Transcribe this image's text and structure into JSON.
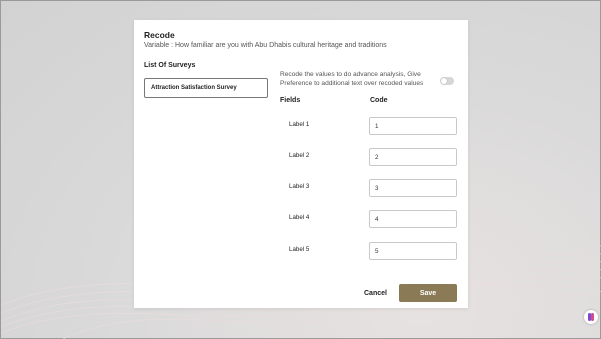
{
  "modal": {
    "title": "Recode",
    "variable": "Variable : How familiar are you with Abu Dhabis cultural heritage and traditions"
  },
  "surveys": {
    "heading": "List Of Surveys",
    "items": [
      "Attraction Satisfaction Survey"
    ]
  },
  "recode": {
    "note": "Recode the values to do advance analysis, Give Preference to additional text over recoded values",
    "toggle_on": false
  },
  "table": {
    "fields_header": "Fields",
    "code_header": "Code",
    "rows": [
      {
        "label": "Label 1",
        "code": "1"
      },
      {
        "label": "Label 2",
        "code": "2"
      },
      {
        "label": "Label 3",
        "code": "3"
      },
      {
        "label": "Label 4",
        "code": "4"
      },
      {
        "label": "Label 5",
        "code": "5"
      }
    ]
  },
  "actions": {
    "cancel": "Cancel",
    "save": "Save"
  },
  "colors": {
    "save_button": "#8a7b56",
    "toggle_off": "#d6d6d6",
    "help_icon_purple": "#7b4ad8",
    "help_icon_pink": "#d24b8a"
  },
  "icons": {
    "toggle": "toggle-switch-icon",
    "help": "help-chat-icon"
  }
}
